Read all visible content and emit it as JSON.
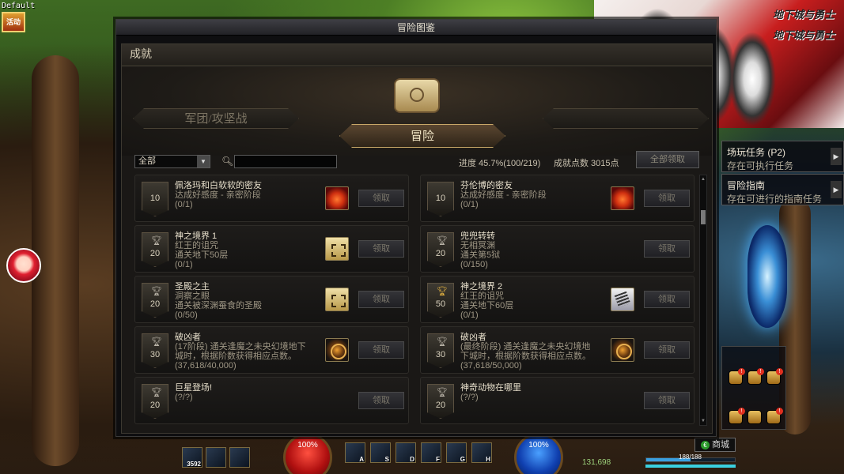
{
  "game": {
    "profile_label": "Default",
    "profile_icon_text": "活动",
    "gold": "131,698",
    "shop_label": "商城",
    "shop_coin": "€",
    "hp_pct": "100%",
    "mp_pct": "100%",
    "exp_text": "188/188",
    "exp_fraction": 0.5,
    "potion_count": "3592",
    "hotkeys": [
      "A",
      "S",
      "D",
      "F",
      "G",
      "H"
    ]
  },
  "promo": {
    "logo_1": "地下城与勇士",
    "logo_2": "地下城与勇士"
  },
  "side_quests": [
    {
      "title": "场玩任务 (P2)",
      "desc": "存在可执行任务"
    },
    {
      "title": "冒险指南",
      "desc": "存在可进行的指南任务"
    }
  ],
  "window": {
    "title": "冒险图鉴",
    "section": "成就",
    "tab_left": "军团/攻坚战",
    "tab_center": "冒险",
    "tab_right": ""
  },
  "filter": {
    "select_value": "全部",
    "search_value": "",
    "progress": "进度  45.7%(100/219)",
    "points": "成就点数 3015点",
    "claim_all": "全部领取"
  },
  "achievements": [
    {
      "medal": "10",
      "trophy": false,
      "title": "佩洛玛和白软软的密友",
      "lines": [
        "达成好感度 - 亲密阶段"
      ],
      "progress": "(0/1)",
      "reward": "heart-icon",
      "claim": "领取"
    },
    {
      "medal": "10",
      "trophy": false,
      "title": "芬伦博的密友",
      "lines": [
        "达成好感度 - 亲密阶段"
      ],
      "progress": "(0/1)",
      "reward": "heart-icon",
      "claim": "领取"
    },
    {
      "medal": "20",
      "trophy": true,
      "title": "神之境界 1",
      "lines": [
        "红王的诅咒",
        "通关地下50层"
      ],
      "progress": "(0/1)",
      "reward": "box-icon",
      "claim": "领取"
    },
    {
      "medal": "20",
      "trophy": true,
      "title": "兜兜转转",
      "lines": [
        "无相冥渊",
        "通关第5狱"
      ],
      "progress": "(0/150)",
      "reward": "",
      "claim": "领取"
    },
    {
      "medal": "20",
      "trophy": true,
      "title": "圣殿之主",
      "lines": [
        "洞察之眼",
        "通关被深渊蚕食的圣殿"
      ],
      "progress": "(0/50)",
      "reward": "box-icon",
      "claim": "领取"
    },
    {
      "medal": "50",
      "trophy": true,
      "gold": true,
      "title": "神之境界 2",
      "lines": [
        "红王的诅咒",
        "通关地下60层"
      ],
      "progress": "(0/1)",
      "reward": "scroll-icon",
      "claim": "领取"
    },
    {
      "medal": "30",
      "trophy": true,
      "title": "破凶者",
      "lines": [
        "(17阶段) 通关逢魔之未央幻境地下",
        "城时，根据阶数获得相应点数。"
      ],
      "progress": "(37,618/40,000)",
      "reward": "emblem-icon",
      "claim": "领取"
    },
    {
      "medal": "30",
      "trophy": true,
      "title": "破凶者",
      "lines": [
        "(最终阶段) 通关逢魔之未央幻境地",
        "下城时，根据阶数获得相应点数。"
      ],
      "progress": "(37,618/50,000)",
      "reward": "emblem-icon",
      "claim": "领取"
    },
    {
      "medal": "20",
      "trophy": true,
      "title": "巨星登场!",
      "lines": [],
      "progress": "(?/?)",
      "reward": "",
      "claim": "领取"
    },
    {
      "medal": "20",
      "trophy": true,
      "title": "神奇动物在哪里",
      "lines": [],
      "progress": "(?/?)",
      "reward": "",
      "claim": "领取"
    }
  ]
}
